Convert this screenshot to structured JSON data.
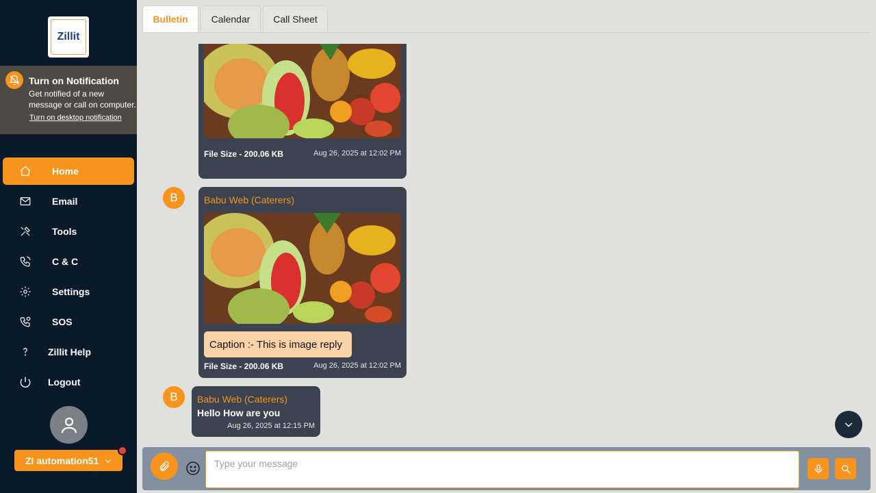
{
  "app": {
    "logo_text": "Zillit"
  },
  "notification": {
    "title": "Turn on Notification",
    "text": "Get notified of a new message or call on computer.",
    "link": "Turn on desktop notification"
  },
  "nav": {
    "home": "Home",
    "email": "Email",
    "tools": "Tools",
    "cc": "C & C",
    "settings": "Settings",
    "sos": "SOS",
    "help": "Zillit Help",
    "logout": "Logout"
  },
  "user": {
    "name": "ZI automation51"
  },
  "tabs": {
    "bulletin": "Bulletin",
    "calendar": "Calendar",
    "call_sheet": "Call Sheet"
  },
  "messages": [
    {
      "file_size": "File Size - 200.06 KB",
      "time": "Aug 26, 2025 at 12:02 PM"
    },
    {
      "avatar": "B",
      "sender": "Babu Web (Caterers)",
      "caption": "Caption :- This is image reply",
      "file_size": "File Size - 200.06 KB",
      "time": "Aug 26, 2025 at 12:02 PM"
    },
    {
      "avatar": "B",
      "sender": "Babu Web (Caterers)",
      "text": "Hello How are you",
      "time": "Aug 26, 2025 at 12:15 PM"
    }
  ],
  "composer": {
    "placeholder": "Type your message"
  },
  "colors": {
    "accent": "#f7941d",
    "sidebar": "#0b1a2b",
    "bubble": "#3b4250"
  }
}
